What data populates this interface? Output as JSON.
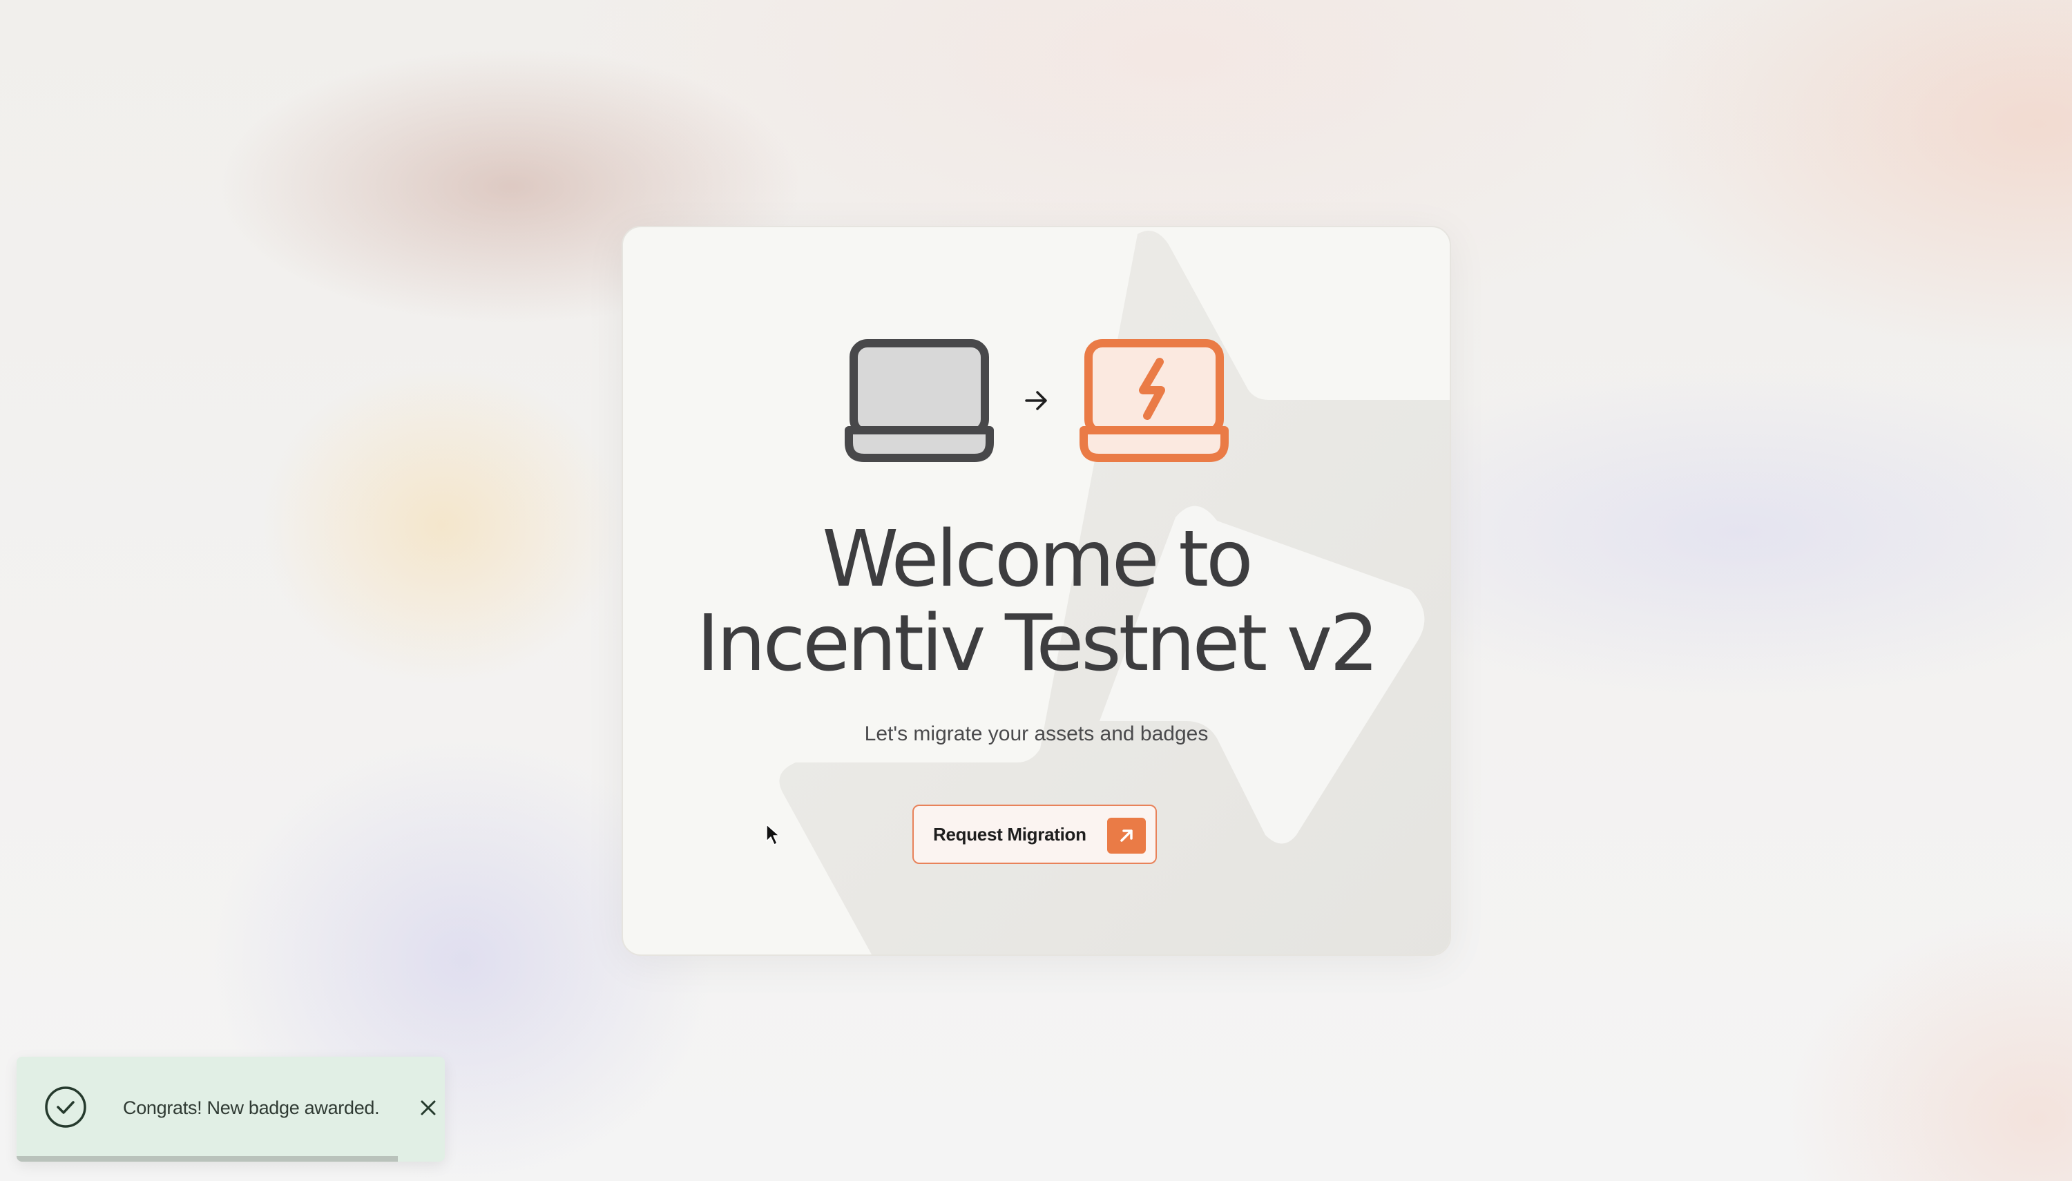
{
  "card": {
    "title_line1": "Welcome to",
    "title_line2": "Incentiv Testnet v2",
    "subtitle": "Let's migrate your assets and badges",
    "cta_label": "Request Migration",
    "icons": {
      "old": "laptop-icon",
      "arrow": "arrow-right-icon",
      "new": "laptop-lightning-icon",
      "cta": "arrow-up-right-icon"
    }
  },
  "toast": {
    "message": "Congrats! New badge awarded.",
    "icon": "check-circle-icon",
    "close_icon": "close-icon",
    "progress": 0.89
  },
  "colors": {
    "accent": "#ea7b46",
    "text_dark": "#3d3d3f",
    "laptop_dark": "#48484a",
    "toast_bg": "#e1efe5"
  }
}
